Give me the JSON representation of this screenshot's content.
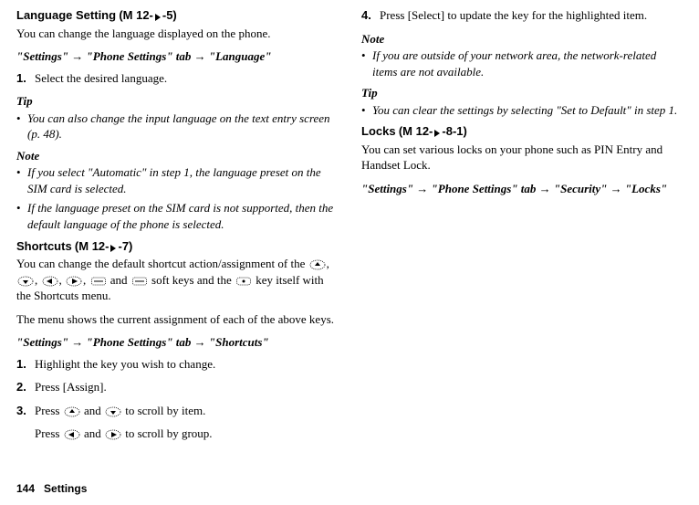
{
  "left": {
    "section1": {
      "title": "Language Setting",
      "mcode_prefix": " (M 12-",
      "mcode_suffix": "-5)",
      "intro": "You can change the language displayed on the phone.",
      "nav": "\"Settings\" → \"Phone Settings\" tab → \"Language\"",
      "step1_num": "1.",
      "step1_text": "Select the desired language.",
      "tip_label": "Tip",
      "tip_text": "You can also change the input language on the text entry screen (p. 48).",
      "note_label": "Note",
      "note1": "If you select \"Automatic\" in step 1, the language preset on the SIM card is selected.",
      "note2": "If the language preset on the SIM card is not supported, then the default language of the phone is selected."
    },
    "section2": {
      "title": "Shortcuts",
      "mcode_prefix": " (M 12-",
      "mcode_suffix": "-7)",
      "intro_pre": "You can change the default shortcut action/assignment of the ",
      "intro_mid1": ", ",
      "intro_mid_and": " and ",
      "intro_mid2": " soft keys and the ",
      "intro_post": " key itself with the Shortcuts menu.",
      "menu_shows": "The menu shows the current assignment of each of the above keys.",
      "nav": "\"Settings\" → \"Phone Settings\" tab → \"Shortcuts\"",
      "step1_num": "1.",
      "step1_text": "Highlight the key you wish to change.",
      "step2_num": "2.",
      "step2_text": "Press [Assign].",
      "step3_num": "3.",
      "step3a_pre": "Press ",
      "step3a_mid": " and ",
      "step3a_post": " to scroll by item.",
      "step3b_pre": "Press ",
      "step3b_mid": " and ",
      "step3b_post": " to scroll by group."
    }
  },
  "right": {
    "step4_num": "4.",
    "step4_text": "Press [Select] to update the key for the highlighted item.",
    "note_label": "Note",
    "note_text": "If you are outside of your network area, the network-related items are not available.",
    "tip_label": "Tip",
    "tip_text": "You can clear the settings by selecting \"Set to Default\" in step 1.",
    "locks": {
      "title": "Locks",
      "mcode_prefix": " (M 12-",
      "mcode_suffix": "-8-1)",
      "intro": "You can set various locks on your phone such as PIN Entry and Handset Lock.",
      "nav": "\"Settings\" → \"Phone Settings\" tab → \"Security\" → \"Locks\""
    }
  },
  "footer": {
    "pagenum": "144",
    "section": "Settings"
  },
  "glyphs": {
    "bullet": "•"
  }
}
